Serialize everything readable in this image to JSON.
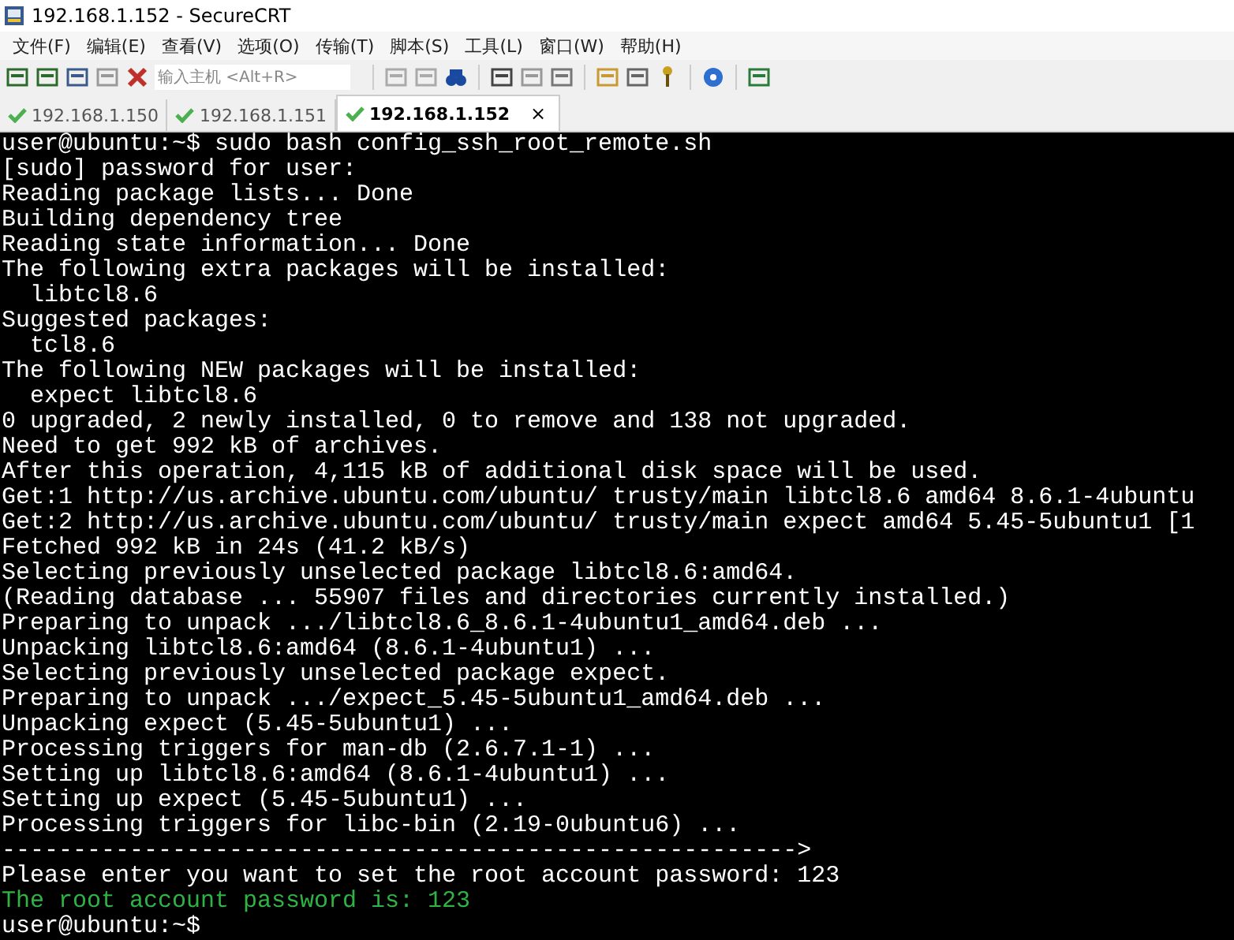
{
  "window": {
    "title": "192.168.1.152 - SecureCRT"
  },
  "menu": [
    "文件(F)",
    "编辑(E)",
    "查看(V)",
    "选项(O)",
    "传输(T)",
    "脚本(S)",
    "工具(L)",
    "窗口(W)",
    "帮助(H)"
  ],
  "toolbar": {
    "host_field": {
      "placeholder": "输入主机 <Alt+R>"
    }
  },
  "tabs": [
    {
      "label": "192.168.1.150",
      "selected": false
    },
    {
      "label": "192.168.1.151",
      "selected": false
    },
    {
      "label": "192.168.1.152",
      "selected": true,
      "close": "×"
    }
  ],
  "terminal": {
    "lines": [
      {
        "text": "user@ubuntu:~$ sudo bash config_ssh_root_remote.sh",
        "color": "#ffffff"
      },
      {
        "text": "[sudo] password for user:",
        "color": "#ffffff"
      },
      {
        "text": "Reading package lists... Done",
        "color": "#ffffff"
      },
      {
        "text": "Building dependency tree",
        "color": "#ffffff"
      },
      {
        "text": "Reading state information... Done",
        "color": "#ffffff"
      },
      {
        "text": "The following extra packages will be installed:",
        "color": "#ffffff"
      },
      {
        "text": "  libtcl8.6",
        "color": "#ffffff"
      },
      {
        "text": "Suggested packages:",
        "color": "#ffffff"
      },
      {
        "text": "  tcl8.6",
        "color": "#ffffff"
      },
      {
        "text": "The following NEW packages will be installed:",
        "color": "#ffffff"
      },
      {
        "text": "  expect libtcl8.6",
        "color": "#ffffff"
      },
      {
        "text": "0 upgraded, 2 newly installed, 0 to remove and 138 not upgraded.",
        "color": "#ffffff"
      },
      {
        "text": "Need to get 992 kB of archives.",
        "color": "#ffffff"
      },
      {
        "text": "After this operation, 4,115 kB of additional disk space will be used.",
        "color": "#ffffff"
      },
      {
        "text": "Get:1 http://us.archive.ubuntu.com/ubuntu/ trusty/main libtcl8.6 amd64 8.6.1-4ubuntu",
        "color": "#ffffff"
      },
      {
        "text": "Get:2 http://us.archive.ubuntu.com/ubuntu/ trusty/main expect amd64 5.45-5ubuntu1 [1",
        "color": "#ffffff"
      },
      {
        "text": "Fetched 992 kB in 24s (41.2 kB/s)",
        "color": "#ffffff"
      },
      {
        "text": "Selecting previously unselected package libtcl8.6:amd64.",
        "color": "#ffffff"
      },
      {
        "text": "(Reading database ... 55907 files and directories currently installed.)",
        "color": "#ffffff"
      },
      {
        "text": "Preparing to unpack .../libtcl8.6_8.6.1-4ubuntu1_amd64.deb ...",
        "color": "#ffffff"
      },
      {
        "text": "Unpacking libtcl8.6:amd64 (8.6.1-4ubuntu1) ...",
        "color": "#ffffff"
      },
      {
        "text": "Selecting previously unselected package expect.",
        "color": "#ffffff"
      },
      {
        "text": "Preparing to unpack .../expect_5.45-5ubuntu1_amd64.deb ...",
        "color": "#ffffff"
      },
      {
        "text": "Unpacking expect (5.45-5ubuntu1) ...",
        "color": "#ffffff"
      },
      {
        "text": "Processing triggers for man-db (2.6.7.1-1) ...",
        "color": "#ffffff"
      },
      {
        "text": "Setting up libtcl8.6:amd64 (8.6.1-4ubuntu1) ...",
        "color": "#ffffff"
      },
      {
        "text": "Setting up expect (5.45-5ubuntu1) ...",
        "color": "#ffffff"
      },
      {
        "text": "Processing triggers for libc-bin (2.19-0ubuntu6) ...",
        "color": "#ffffff"
      },
      {
        "text": "-------------------------------------------------------->",
        "color": "#ffffff"
      },
      {
        "text": "Please enter you want to set the root account password: 123",
        "color": "#ffffff"
      },
      {
        "text": "The root account password is: 123",
        "color": "#2fb344"
      },
      {
        "text": "user@ubuntu:~$",
        "color": "#ffffff"
      }
    ]
  }
}
